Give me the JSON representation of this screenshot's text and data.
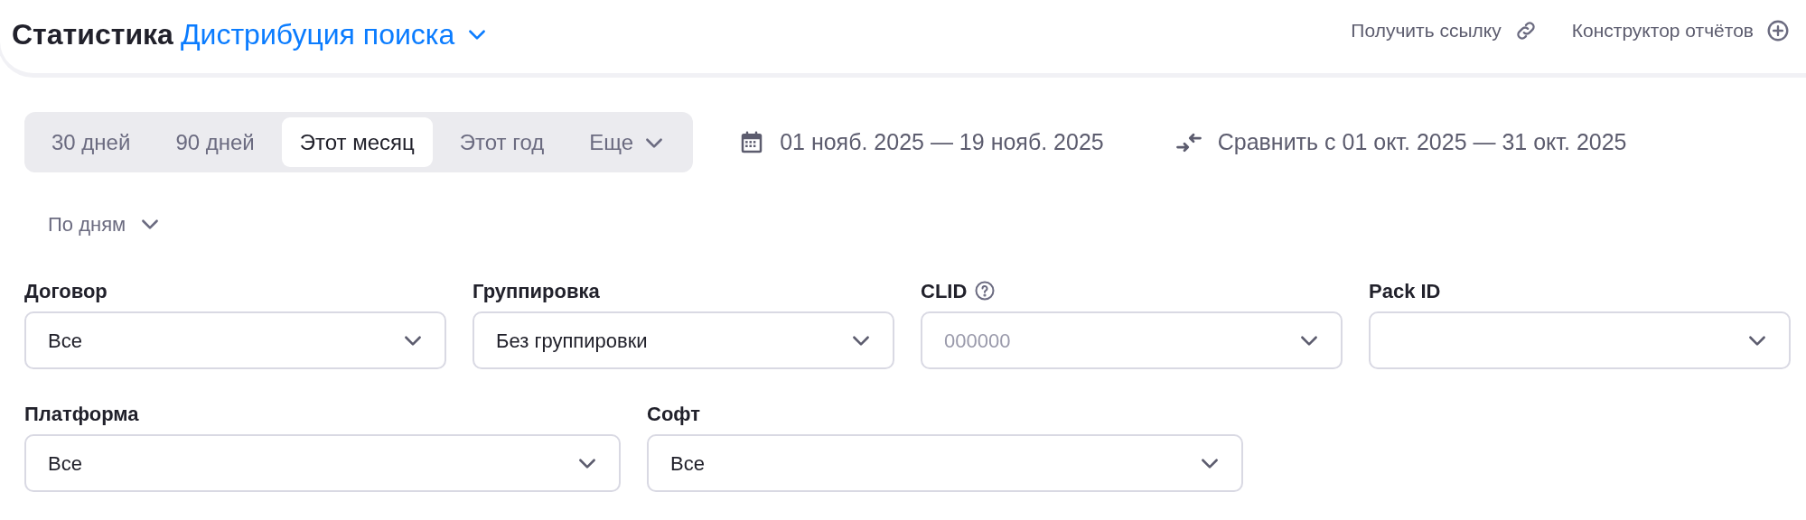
{
  "header": {
    "title": "Статистика",
    "report": "Дистрибуция поиска",
    "actions": [
      {
        "label": "Получить ссылку",
        "kind": "link"
      },
      {
        "label": "Конструктор отчётов",
        "kind": "add"
      }
    ]
  },
  "periods": [
    {
      "label": "30 дней",
      "selected": false,
      "kind": "preset"
    },
    {
      "label": "90 дней",
      "selected": false,
      "kind": "preset"
    },
    {
      "label": "Этот месяц",
      "selected": true,
      "kind": "preset"
    },
    {
      "label": "Этот год",
      "selected": false,
      "kind": "preset"
    },
    {
      "label": "Еще",
      "selected": false,
      "kind": "menu"
    }
  ],
  "date_range": "01 нояб. 2025 — 19 нояб. 2025",
  "compare": "Сравнить с 01 окт. 2025 — 31 окт. 2025",
  "granularity": "По дням",
  "filter_rows": [
    [
      {
        "label": "Договор",
        "value": "Все",
        "help": false
      },
      {
        "label": "Группировка",
        "value": "Без группировки",
        "help": false
      },
      {
        "label": "CLID",
        "placeholder": "000000",
        "help": true
      },
      {
        "label": "Pack ID",
        "help": false
      }
    ],
    [
      {
        "label": "Платформа",
        "value": "Все",
        "help": false
      },
      {
        "label": "Софт",
        "value": "Все",
        "help": false
      }
    ]
  ]
}
